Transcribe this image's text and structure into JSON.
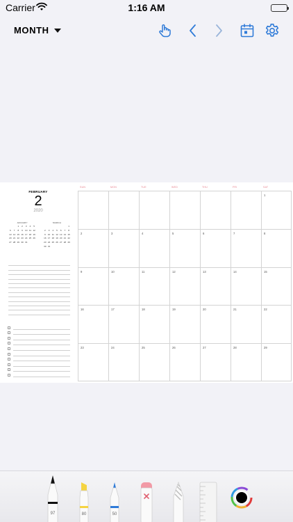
{
  "status_bar": {
    "carrier": "Carrier",
    "time": "1:16 AM"
  },
  "toolbar": {
    "view_label": "MONTH",
    "icons": [
      "touch-hand-icon",
      "chevron-left-icon",
      "chevron-right-icon",
      "calendar-today-icon",
      "gear-icon"
    ],
    "accent": "#2f7bd8"
  },
  "planner": {
    "month_name": "FEBRUARY",
    "day": "2",
    "year": "2020",
    "mini_prev": {
      "name": "JANUARY",
      "days": [
        "",
        "",
        "1",
        "2",
        "3",
        "4",
        "5",
        "6",
        "7",
        "8",
        "9",
        "10",
        "11",
        "12",
        "13",
        "14",
        "15",
        "16",
        "17",
        "18",
        "19",
        "20",
        "21",
        "22",
        "23",
        "24",
        "25",
        "26",
        "27",
        "28",
        "29",
        "30",
        "31"
      ]
    },
    "mini_next": {
      "name": "MARCH",
      "days": [
        "",
        "",
        "",
        "",
        "",
        "",
        "1",
        "2",
        "3",
        "4",
        "5",
        "6",
        "7",
        "8",
        "9",
        "10",
        "11",
        "12",
        "13",
        "14",
        "15",
        "16",
        "17",
        "18",
        "19",
        "20",
        "21",
        "22",
        "23",
        "24",
        "25",
        "26",
        "27",
        "28",
        "29",
        "30",
        "31"
      ]
    },
    "weekdays": [
      "SUN",
      "MON",
      "TUE",
      "WED",
      "THU",
      "FRI",
      "SAT"
    ],
    "weeks": [
      [
        "",
        "",
        "",
        "",
        "",
        "",
        "1"
      ],
      [
        "2",
        "3",
        "4",
        "5",
        "6",
        "7",
        "8"
      ],
      [
        "9",
        "10",
        "11",
        "12",
        "13",
        "14",
        "15"
      ],
      [
        "16",
        "17",
        "18",
        "19",
        "20",
        "21",
        "22"
      ],
      [
        "23",
        "24",
        "25",
        "26",
        "27",
        "28",
        "29"
      ]
    ],
    "weekday_color": "#e8828e"
  },
  "tools": [
    {
      "name": "pen-tool",
      "label": "97",
      "color": "#111111"
    },
    {
      "name": "highlighter-tool",
      "label": "80",
      "color": "#f5d442"
    },
    {
      "name": "fineliner-tool",
      "label": "50",
      "color": "#2f7bd8"
    },
    {
      "name": "eraser-tool",
      "label": "",
      "color": "#f29aa6"
    },
    {
      "name": "lasso-tool",
      "label": "",
      "color": "#bdbdbd"
    },
    {
      "name": "ruler-tool",
      "label": "",
      "color": "#e4e4e4"
    },
    {
      "name": "color-picker-tool",
      "label": "",
      "color": "#000000"
    }
  ]
}
